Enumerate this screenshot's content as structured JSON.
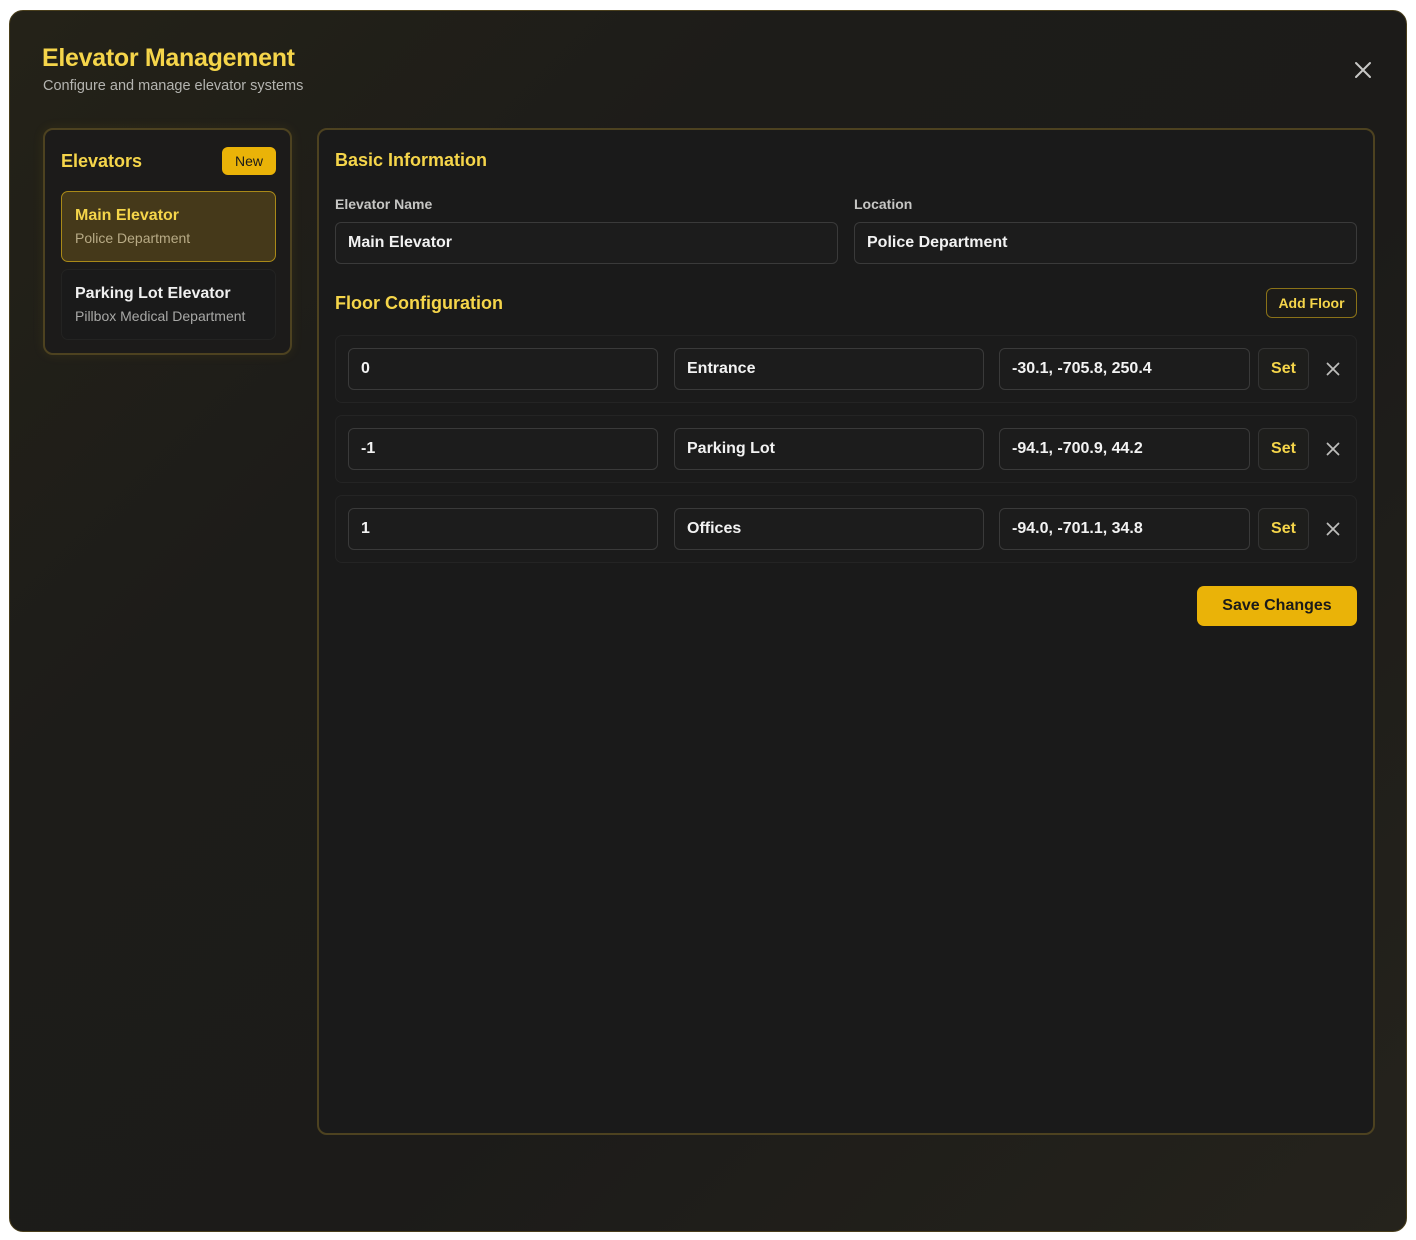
{
  "header": {
    "title": "Elevator Management",
    "subtitle": "Configure and manage elevator systems",
    "close_icon": "close-icon"
  },
  "sidebar": {
    "title": "Elevators",
    "new_label": "New",
    "items": [
      {
        "name": "Main Elevator",
        "location": "Police Department",
        "active": true
      },
      {
        "name": "Parking Lot Elevator",
        "location": "Pillbox Medical Department",
        "active": false
      }
    ]
  },
  "basic_info": {
    "title": "Basic Information",
    "name_label": "Elevator Name",
    "name_value": "Main Elevator",
    "location_label": "Location",
    "location_value": "Police Department"
  },
  "floors": {
    "title": "Floor Configuration",
    "add_label": "Add Floor",
    "set_label": "Set",
    "rows": [
      {
        "floor": "0",
        "name": "Entrance",
        "coords": "-30.1, -705.8, 250.4"
      },
      {
        "floor": "-1",
        "name": "Parking Lot",
        "coords": "-94.1, -700.9, 44.2"
      },
      {
        "floor": "1",
        "name": "Offices",
        "coords": "-94.0, -701.1, 34.8"
      }
    ]
  },
  "save_label": "Save Changes",
  "colors": {
    "accent": "#eab308",
    "accent_text": "#f5d54a",
    "background": "#1a1a1a"
  }
}
